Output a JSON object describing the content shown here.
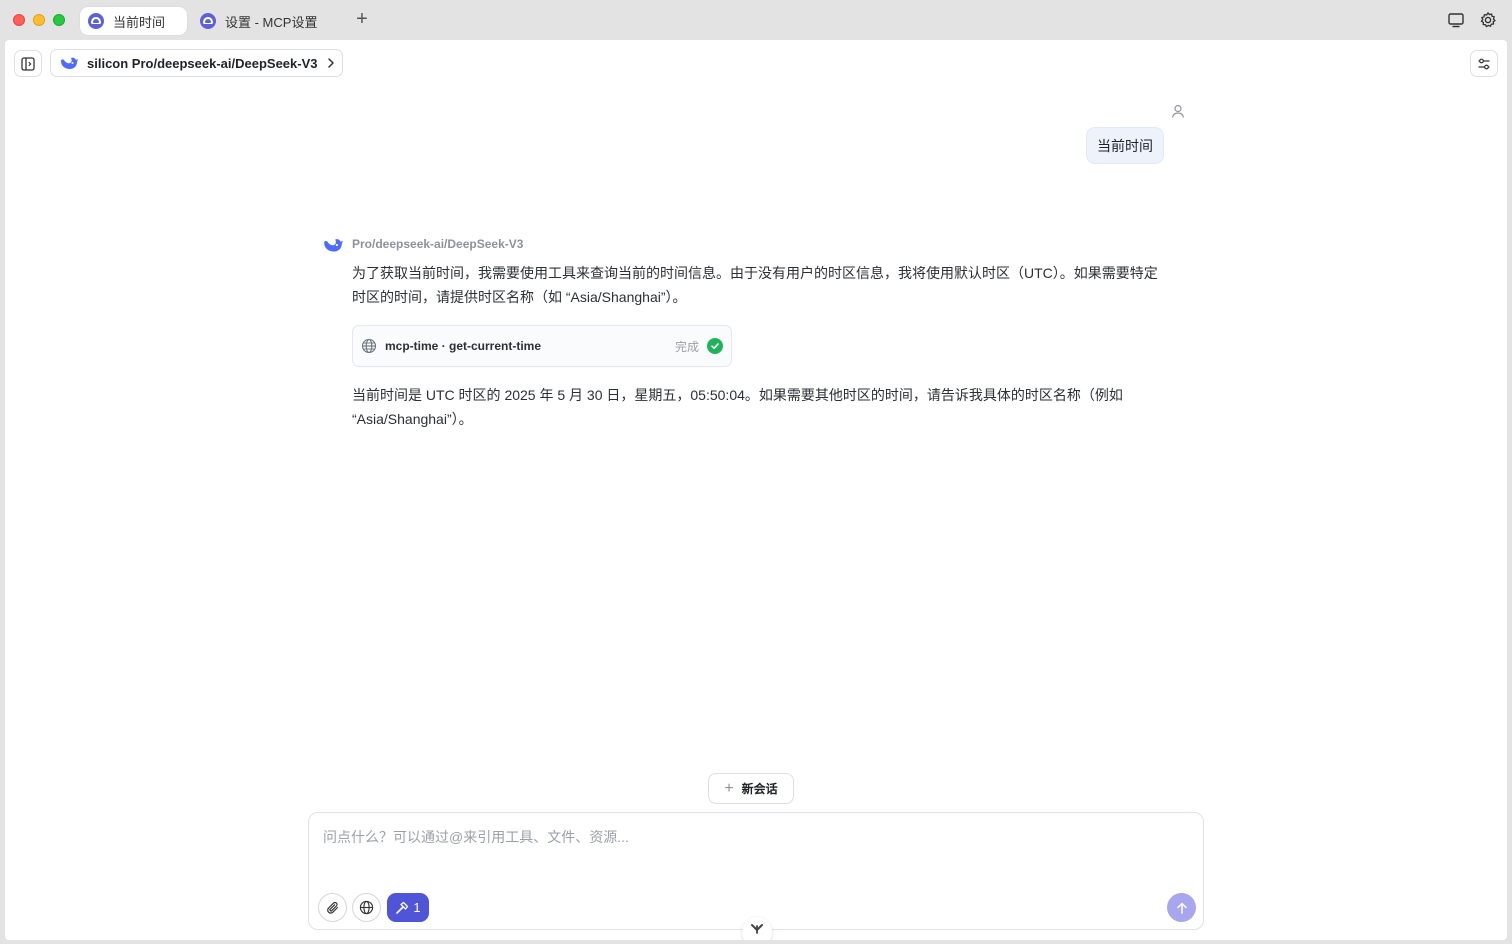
{
  "window": {
    "tabs": [
      {
        "label": "当前时间",
        "active": true
      },
      {
        "label": "设置 - MCP设置",
        "active": false
      }
    ],
    "new_tab_label": "+"
  },
  "header": {
    "model_label": "silicon Pro/deepseek-ai/DeepSeek-V3"
  },
  "conversation": {
    "user_message": "当前时间",
    "assistant": {
      "name": "Pro/deepseek-ai/DeepSeek-V3",
      "text_before_tool": "为了获取当前时间，我需要使用工具来查询当前的时间信息。由于没有用户的时区信息，我将使用默认时区（UTC）。如果需要特定时区的时间，请提供时区名称（如 “Asia/Shanghai”）。",
      "tool_call": {
        "name": "mcp-time · get-current-time",
        "status": "完成"
      },
      "text_after_tool": "当前时间是 UTC 时区的 2025 年 5 月 30 日，星期五，05:50:04。如果需要其他时区的时间，请告诉我具体的时区名称（例如 “Asia/Shanghai”）。"
    }
  },
  "new_chat_label": "新会话",
  "composer": {
    "placeholder": "问点什么？可以通过@来引用工具、文件、资源...",
    "value": "",
    "tools_count": "1"
  },
  "colors": {
    "accent": "#4f55d6",
    "send_disabled": "#a9a6f0",
    "success": "#22b35a",
    "user_bubble": "#eef3fb"
  }
}
